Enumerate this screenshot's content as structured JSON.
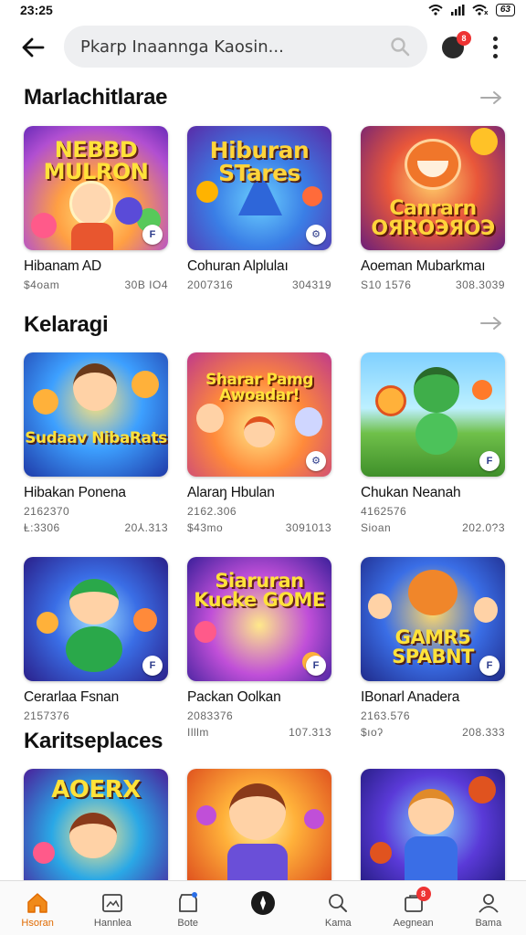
{
  "status_bar": {
    "time": "23:25",
    "battery": "63"
  },
  "search": {
    "placeholder": "Pkarp Inaannga Kaosin...",
    "value": "Pkarp Inaannga Kaosin..."
  },
  "notification_badge": "8",
  "sections": [
    {
      "title": "Marlachitlarae",
      "cards": [
        {
          "art_text": "NEBBD MULRON",
          "title": "Hibanam AD",
          "sub_left": "$4oam",
          "sub_right": "30B IO4"
        },
        {
          "art_text": "Hiburan STares",
          "title": "Cohuran Alplulaı",
          "sub_left": "2007316",
          "sub_right": "304319"
        },
        {
          "art_text": "Canrarn ОЯRОЭЯОЭ",
          "title": "Aoeman Mubarkmaı",
          "sub_left": "S10 1576",
          "sub_right": "308.3039"
        }
      ]
    },
    {
      "title": "Kelaragi",
      "cards": [
        {
          "art_text": "Sudaav NibaRats",
          "title": "Hibakan Ponena",
          "sub_left": "2162370",
          "meta_left": "Ⱡ:3306",
          "meta_right": "20⅄.313"
        },
        {
          "art_text": "Sharar Pamg Awoadar!",
          "title": "Alaraŋ Hbulan",
          "sub_left": "2162.306",
          "meta_left": "$43mo",
          "meta_right": "3091013"
        },
        {
          "art_text": "",
          "title": "Chukan Neanah",
          "sub_left": "4162576",
          "meta_left": "Sioan",
          "meta_right": "202.0?3"
        }
      ]
    },
    {
      "title": "",
      "cards": [
        {
          "art_text": "",
          "title": "Cerarlaa Fsnan",
          "sub_left": "2157376",
          "meta_left": "",
          "meta_right": ""
        },
        {
          "art_text": "Siaruran Kucke GOME",
          "title": "Packan Oolkan",
          "sub_left": "2083376",
          "meta_left": "Illlm",
          "meta_right": "107.313"
        },
        {
          "art_text": "GAMR5 SPABNT",
          "title": "IBonarl Anadera",
          "sub_left": "2163.576",
          "meta_left": "$ıoʔ",
          "meta_right": "208.333"
        }
      ]
    },
    {
      "title": "Karitseplaces",
      "cards": [
        {
          "art_text": "AOERX"
        },
        {
          "art_text": ""
        },
        {
          "art_text": ""
        }
      ]
    }
  ],
  "bottom_nav": [
    {
      "label": "Hsoran",
      "icon": "home-icon",
      "active": true
    },
    {
      "label": "Hannlea",
      "icon": "gallery-icon",
      "active": false
    },
    {
      "label": "Bote",
      "icon": "box-icon",
      "active": false
    },
    {
      "label": "",
      "icon": "compass-icon",
      "active": false
    },
    {
      "label": "Kama",
      "icon": "search-icon",
      "active": false
    },
    {
      "label": "Aegnean",
      "icon": "bag-icon",
      "active": false,
      "badge": "8"
    },
    {
      "label": "Bama",
      "icon": "profile-icon",
      "active": false
    }
  ],
  "colors": {
    "accent": "#e06a00",
    "badge": "#e33333",
    "search_bg": "#eeeff1"
  }
}
